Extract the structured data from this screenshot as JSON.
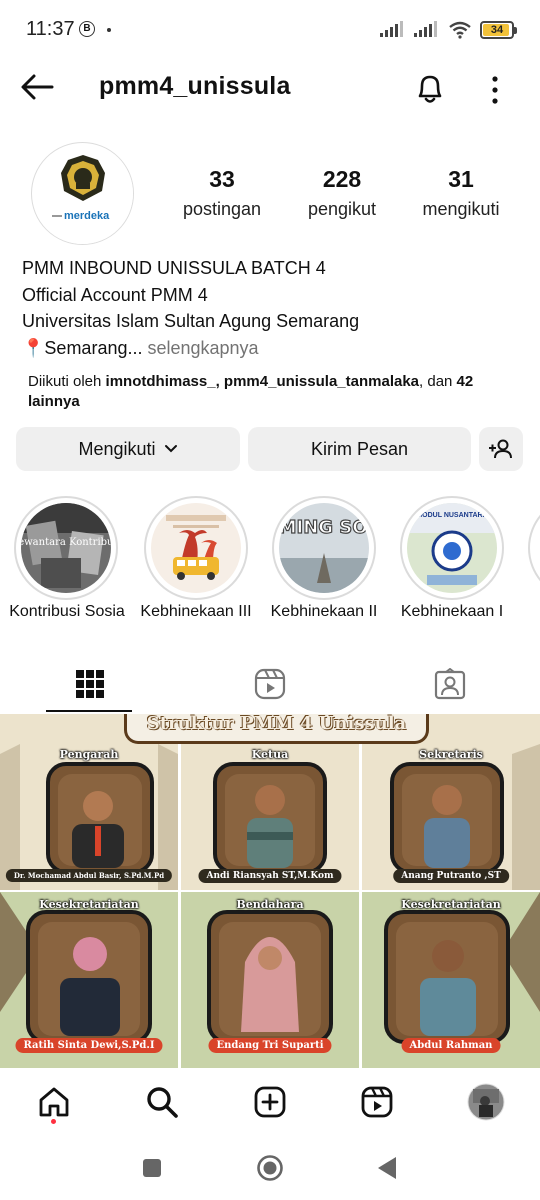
{
  "status_bar": {
    "time": "11:37",
    "notif_letter": "B",
    "battery": "34",
    "battery_color": "#f2c23a"
  },
  "top_bar": {
    "username": "pmm4_unissula",
    "back_icon": "arrow-left-icon",
    "bell_icon": "bell-icon",
    "more_icon": "more-vertical-icon"
  },
  "profile": {
    "avatar_text": "merdeka",
    "stats": [
      {
        "value": "33",
        "label": "postingan"
      },
      {
        "value": "228",
        "label": "pengikut"
      },
      {
        "value": "31",
        "label": "mengikuti"
      }
    ],
    "bio": {
      "name": "PMM INBOUND UNISSULA BATCH 4",
      "line1": "Official Account PMM 4",
      "line2": "Universitas Islam Sultan Agung Semarang",
      "location_pin": "📍",
      "location": "Semarang...",
      "more": " selengkapnya"
    },
    "followed_by": {
      "prefix": "Diikuti oleh ",
      "user1": "imnotdhimass_",
      "sep": ", ",
      "user2": "pmm4_unissula_tanmalaka",
      "mid": ", dan ",
      "count": "42",
      "suffix": " lainnya"
    }
  },
  "actions": {
    "following_label": "Mengikuti",
    "message_label": "Kirim Pesan",
    "add_person_icon": "person-add-icon"
  },
  "highlights": [
    {
      "label": "Kontribusi Sosia",
      "cover_text": "Dewantara Kontribusi"
    },
    {
      "label": "Kebhinekaan III",
      "cover_text": ""
    },
    {
      "label": "Kebhinekaan II",
      "cover_text": "COMING SOON"
    },
    {
      "label": "Kebhinekaan I",
      "cover_text": "MODUL NUSANTARA"
    }
  ],
  "tabs": [
    {
      "name": "grid",
      "icon": "grid-icon"
    },
    {
      "name": "reels",
      "icon": "reels-icon"
    },
    {
      "name": "tagged",
      "icon": "tagged-icon"
    }
  ],
  "grid": {
    "banner": "Struktur PMM 4 Unissula",
    "posts": [
      {
        "role": "Pengarah",
        "name": "Dr. Mochamad Abdul Basir, S.Pd.M.Pd"
      },
      {
        "role": "Ketua",
        "name": "Andi Riansyah ST,M.Kom"
      },
      {
        "role": "Sekretaris",
        "name": "Anang Putranto ,ST"
      },
      {
        "role": "Kesekretariatan",
        "name": "Ratih Sinta Dewi,S.Pd.I"
      },
      {
        "role": "Bendahara",
        "name": "Endang Tri Suparti"
      },
      {
        "role": "Kesekretariatan",
        "name": "Abdul Rahman"
      }
    ]
  },
  "bottom_nav": [
    {
      "name": "home",
      "icon": "home-icon"
    },
    {
      "name": "search",
      "icon": "search-icon"
    },
    {
      "name": "create",
      "icon": "plus-square-icon"
    },
    {
      "name": "reels",
      "icon": "reels-icon"
    },
    {
      "name": "profile",
      "icon": "avatar-icon"
    }
  ],
  "colors": {
    "nameplate_dark": "#2f2a1e",
    "nameplate_red": "#d9442a",
    "frame_brown": "#6b4a25",
    "notification_dot": "#ff3040"
  }
}
